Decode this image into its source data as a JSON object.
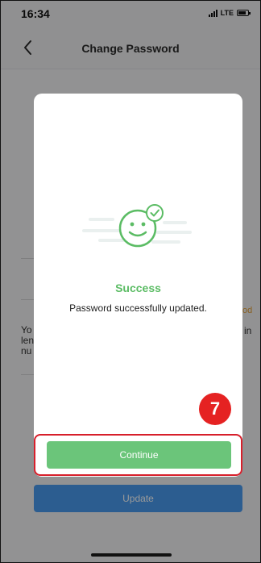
{
  "status_bar": {
    "time": "16:34",
    "network": "LTE"
  },
  "nav": {
    "title": "Change Password"
  },
  "page": {
    "hint_left": "Yo\nlen\nnu",
    "hint_accent": "od",
    "hint_right": "in",
    "update_label": "Update"
  },
  "modal": {
    "title": "Success",
    "message": "Password successfully updated.",
    "continue_label": "Continue",
    "success_color": "#5bbc64"
  },
  "annotation": {
    "step_number": "7",
    "badge_color": "#e52222"
  }
}
